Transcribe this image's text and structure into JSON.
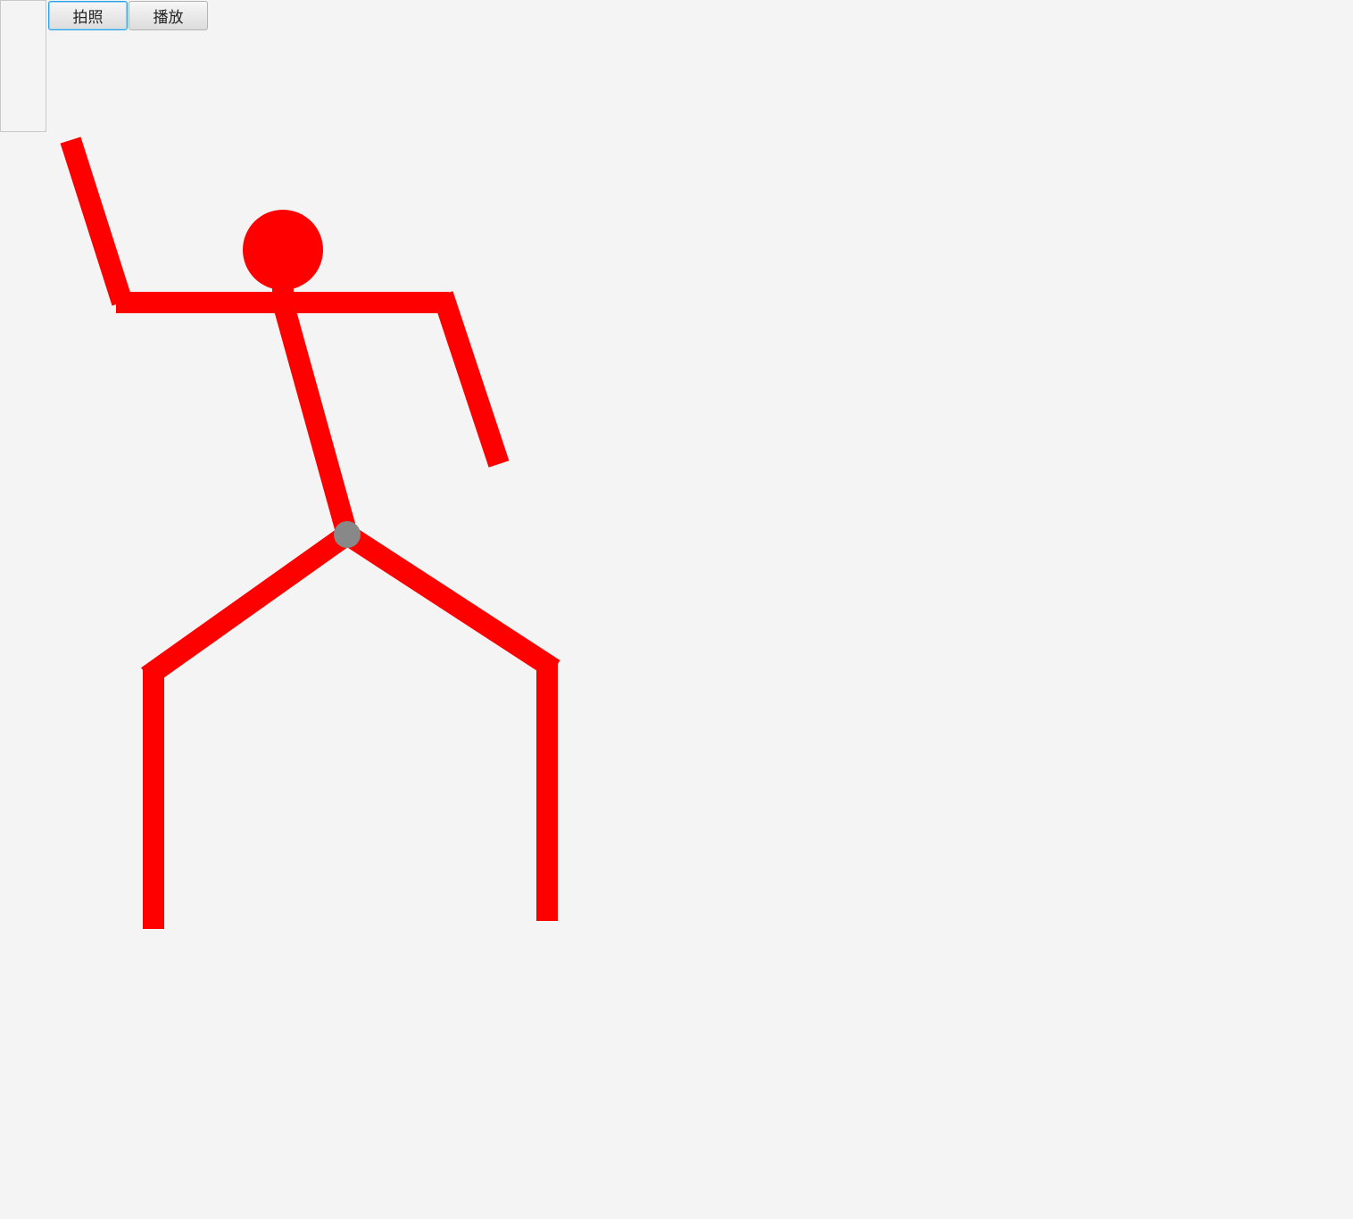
{
  "toolbar": {
    "photo_label": "拍照",
    "play_label": "播放"
  },
  "colors": {
    "limb": "#ff0000",
    "joint": "#888888",
    "background": "#f4f4f4"
  }
}
